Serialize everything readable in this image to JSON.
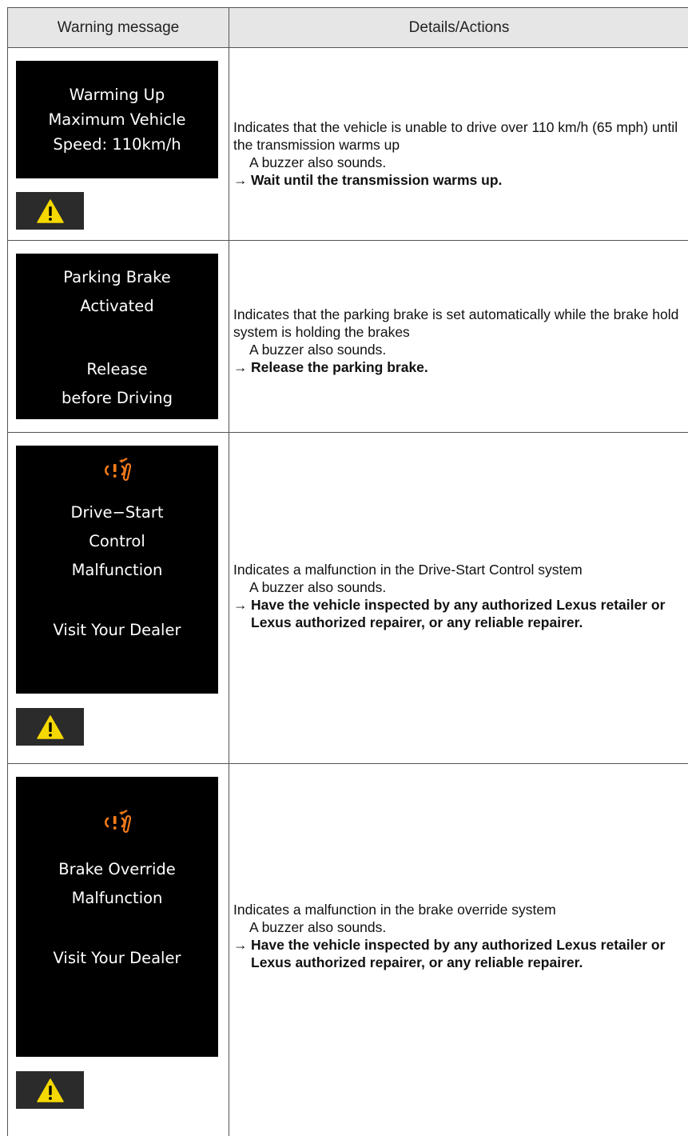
{
  "header": {
    "col1": "Warning message",
    "col2": "Details/Actions"
  },
  "colors": {
    "screen_bg": "#000000",
    "screen_text": "#ffffff",
    "icon_orange": "#f07a1a",
    "warning_yellow": "#f5d800"
  },
  "rows": [
    {
      "screen_lines": [
        "Warming Up",
        "Maximum Vehicle",
        "Speed: 110km/h"
      ],
      "icon": "warning-triangle-icon",
      "details": "Indicates that the vehicle is unable to drive over 110 km/h (65 mph) until the transmission warms up",
      "buzzer": "A buzzer also sounds.",
      "action": "Wait until the transmission warms up."
    },
    {
      "screen_lines": [
        "Parking Brake",
        "Activated",
        "Release",
        "before Driving"
      ],
      "details": "Indicates that the parking brake is set automatically while the brake hold system is holding the brakes",
      "buzzer": "A buzzer also sounds.",
      "action": "Release the parking brake."
    },
    {
      "screen_icon": "pedal-warning-icon",
      "screen_lines": [
        "Drive−Start",
        "Control",
        "Malfunction",
        "Visit Your Dealer"
      ],
      "icon": "warning-triangle-icon",
      "details": "Indicates a malfunction in the Drive-Start Control system",
      "buzzer": "A buzzer also sounds.",
      "action": "Have the vehicle inspected by any authorized Lexus retailer or Lexus authorized repairer, or any reliable repairer."
    },
    {
      "screen_icon": "pedal-warning-icon",
      "screen_lines": [
        "Brake Override",
        "Malfunction",
        "Visit Your Dealer"
      ],
      "icon": "warning-triangle-icon",
      "details": "Indicates a malfunction in the brake override system",
      "buzzer": "A buzzer also sounds.",
      "action": "Have the vehicle inspected by any authorized Lexus retailer or Lexus authorized repairer, or any reliable repairer."
    }
  ],
  "arrow": "→"
}
